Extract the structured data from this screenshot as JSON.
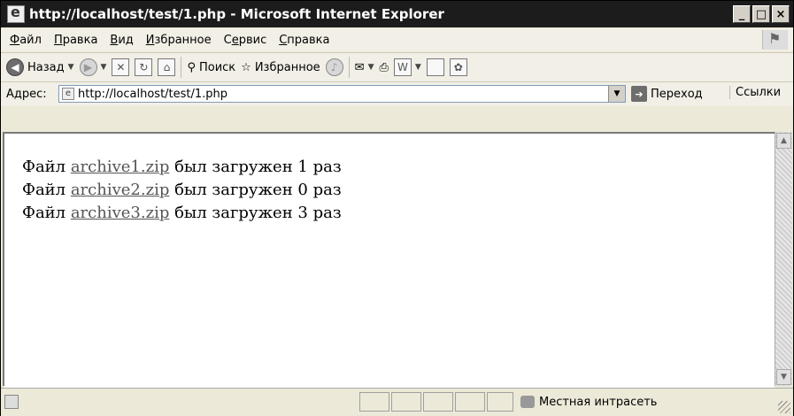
{
  "window": {
    "title": "http://localhost/test/1.php - Microsoft Internet Explorer",
    "caption_buttons": [
      "_",
      "□",
      "×"
    ]
  },
  "menu": {
    "items": [
      {
        "pre": "",
        "u": "Ф",
        "post": "айл"
      },
      {
        "pre": "",
        "u": "П",
        "post": "равка"
      },
      {
        "pre": "",
        "u": "В",
        "post": "ид"
      },
      {
        "pre": "",
        "u": "И",
        "post": "збранное"
      },
      {
        "pre": "С",
        "u": "е",
        "post": "рвис"
      },
      {
        "pre": "",
        "u": "С",
        "post": "правка"
      }
    ]
  },
  "toolbar": {
    "back_label": "Назад",
    "search_label": "Поиск",
    "favorites_label": "Избранное"
  },
  "address": {
    "label": "Адрес:",
    "url": "http://localhost/test/1.php",
    "go_label": "Переход",
    "links_label": "Ссылки"
  },
  "content": {
    "lines": [
      {
        "prefix": "Файл ",
        "link": "archive1.zip",
        "suffix": " был загружен 1 раз"
      },
      {
        "prefix": "Файл ",
        "link": "archive2.zip",
        "suffix": " был загружен 0 раз"
      },
      {
        "prefix": "Файл ",
        "link": "archive3.zip",
        "suffix": " был загружен 3 раз"
      }
    ]
  },
  "status": {
    "zone": "Местная интрасеть"
  }
}
